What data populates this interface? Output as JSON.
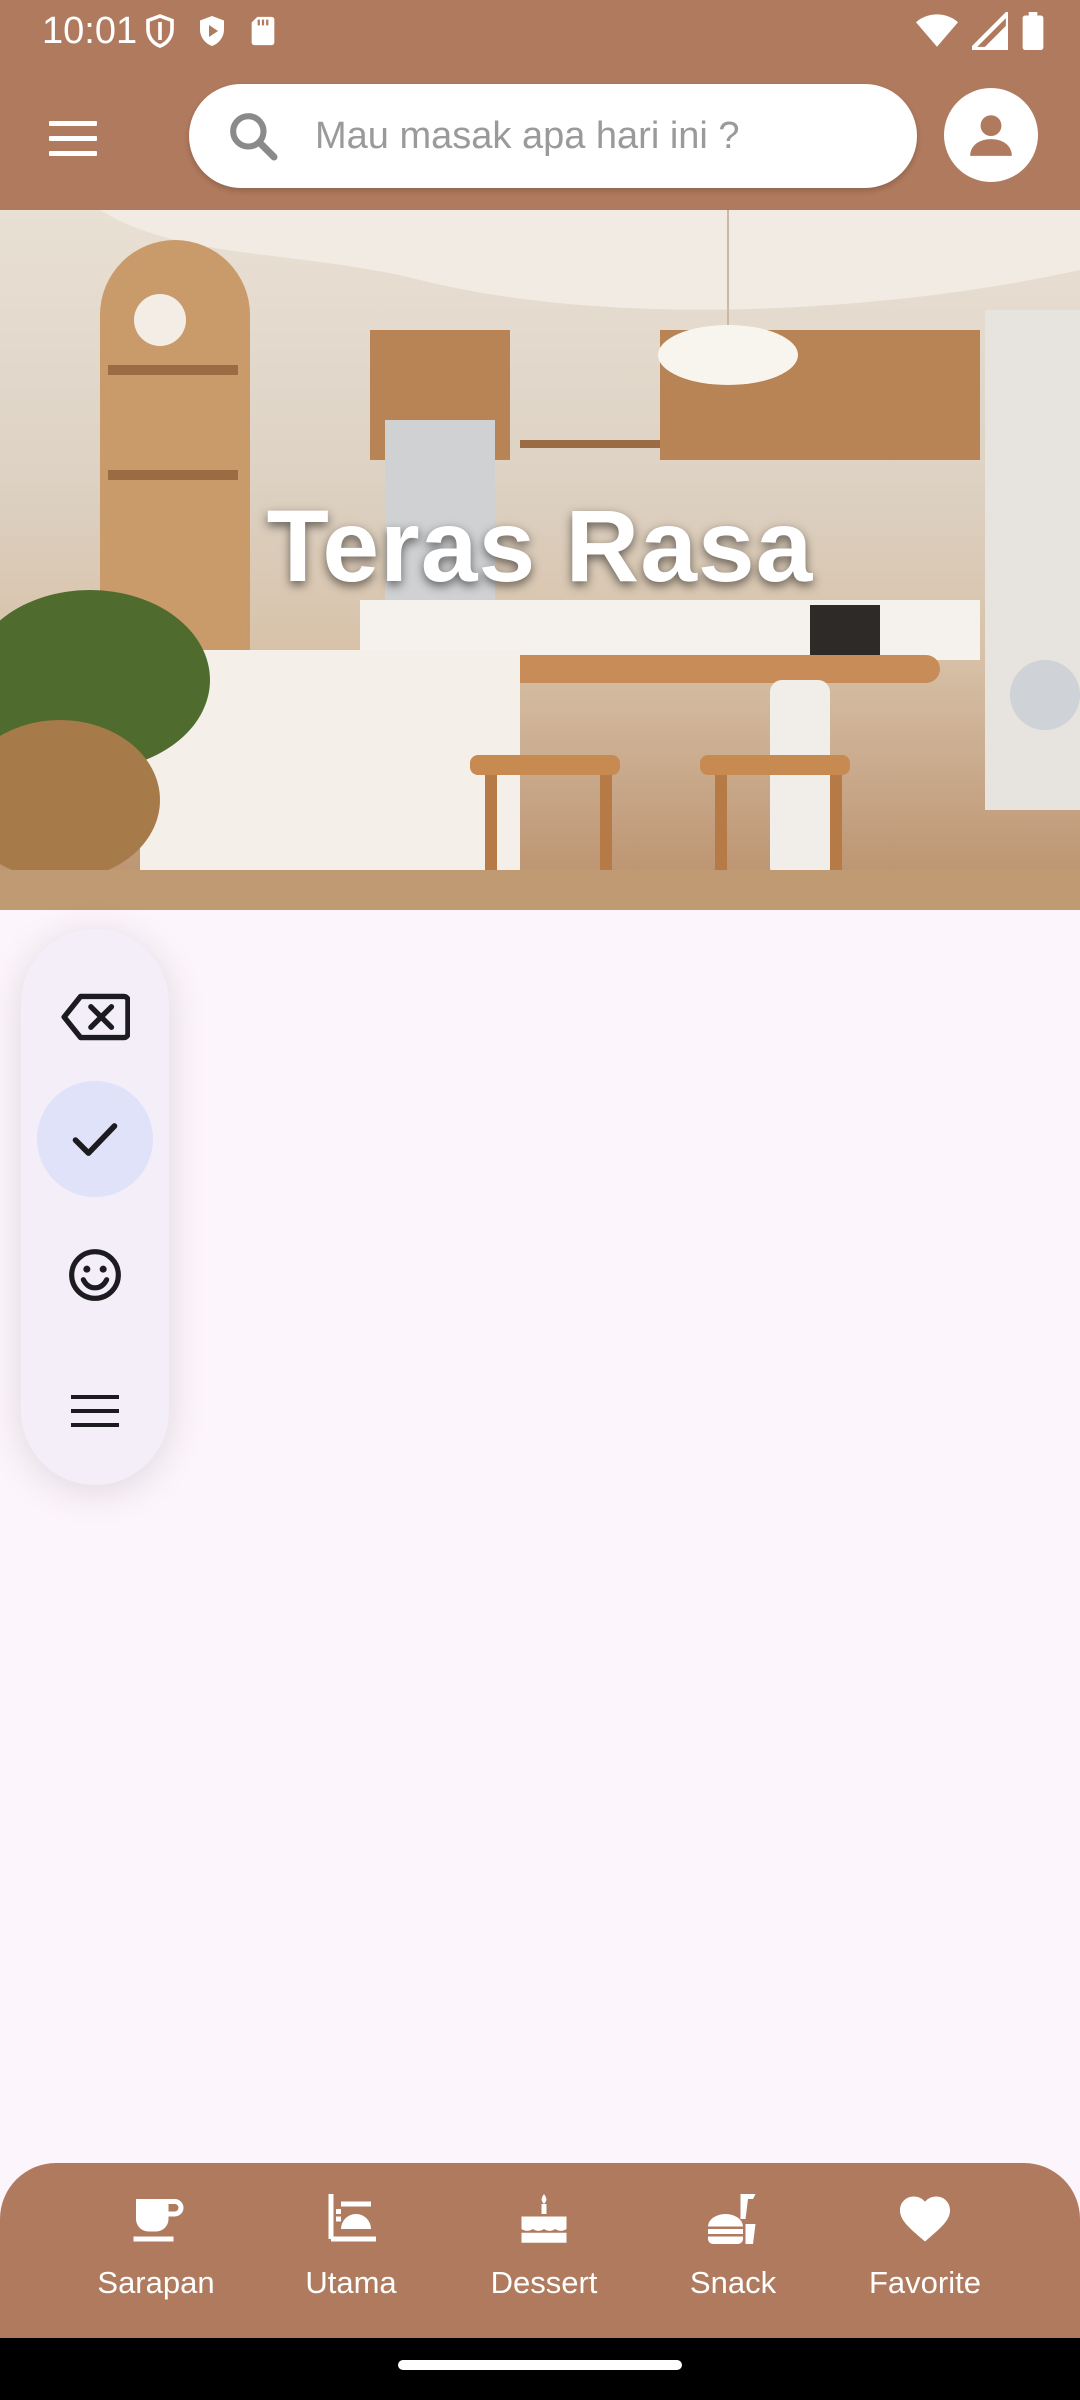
{
  "status_bar": {
    "time": "10:01",
    "icons": [
      "shield-icon",
      "play-protect-icon",
      "sd-card-icon",
      "wifi-icon",
      "signal-icon",
      "battery-icon"
    ]
  },
  "app_bar": {
    "menu_icon": "menu-icon",
    "search": {
      "placeholder": "Mau masak apa hari ini ?",
      "value": ""
    },
    "avatar_icon": "person-icon"
  },
  "hero": {
    "title": "Teras Rasa",
    "image_description_colors": [
      "#e9e0d4",
      "#b98e6a"
    ]
  },
  "rail": {
    "items": [
      {
        "icon": "backspace-icon",
        "selected": false
      },
      {
        "icon": "check-icon",
        "selected": true
      },
      {
        "icon": "smiley-icon",
        "selected": false
      },
      {
        "icon": "menu-lines-icon",
        "selected": false
      }
    ]
  },
  "bottom_nav": {
    "items": [
      {
        "label": "Sarapan",
        "icon": "coffee-cup-icon"
      },
      {
        "label": "Utama",
        "icon": "dining-icon"
      },
      {
        "label": "Dessert",
        "icon": "cake-icon"
      },
      {
        "label": "Snack",
        "icon": "fastfood-icon"
      },
      {
        "label": "Favorite",
        "icon": "heart-icon"
      }
    ]
  },
  "colors": {
    "brand": "#b07a5e",
    "background": "#fcf5fb",
    "rail_bg": "#f4eef8",
    "rail_selected": "#dfe2f8"
  }
}
